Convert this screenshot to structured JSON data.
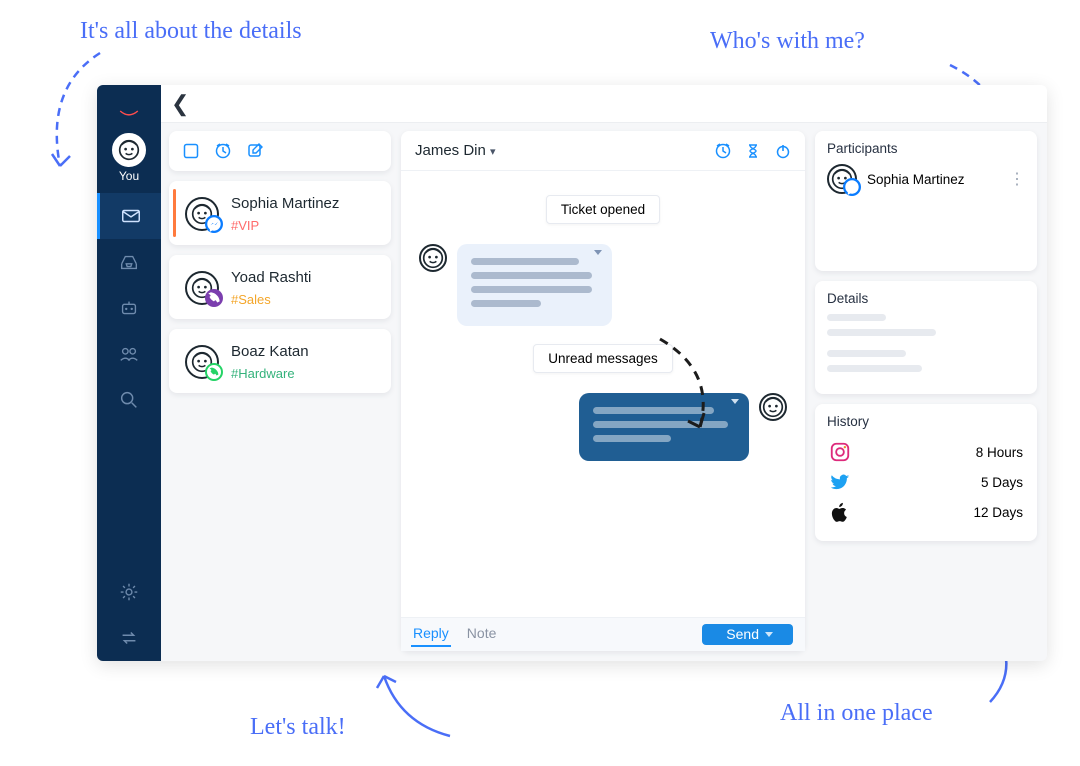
{
  "annotations": {
    "top_left": "It's all about the details",
    "top_right": "Who's with me?",
    "bottom_left": "Let's talk!",
    "bottom_right": "All in one place"
  },
  "nav": {
    "me_label": "You"
  },
  "conversations": [
    {
      "name": "Sophia Martinez",
      "tag": "#VIP",
      "tag_class": "tag-vip",
      "channel": "messenger",
      "active": true
    },
    {
      "name": "Yoad Rashti",
      "tag": "#Sales",
      "tag_class": "tag-sales",
      "channel": "viber",
      "active": false
    },
    {
      "name": "Boaz Katan",
      "tag": "#Hardware",
      "tag_class": "tag-hardware",
      "channel": "whatsapp",
      "active": false
    }
  ],
  "thread": {
    "title": "James Din",
    "chip_opened": "Ticket opened",
    "chip_unread": "Unread messages",
    "reply_tab": "Reply",
    "note_tab": "Note",
    "send_label": "Send"
  },
  "right": {
    "participants_title": "Participants",
    "participant_name": "Sophia Martinez",
    "details_title": "Details",
    "history_title": "History",
    "history": [
      {
        "channel": "instagram",
        "label": "8 Hours"
      },
      {
        "channel": "twitter",
        "label": "5 Days"
      },
      {
        "channel": "apple",
        "label": "12 Days"
      }
    ]
  }
}
